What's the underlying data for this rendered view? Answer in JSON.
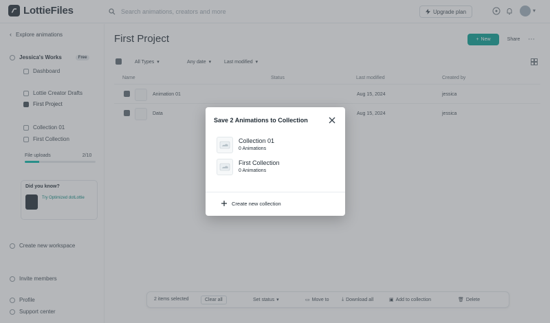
{
  "app": {
    "name": "LottieFiles"
  },
  "search": {
    "placeholder": "Search animations, creators and more"
  },
  "header": {
    "upgrade_label": "Upgrade plan",
    "user_initial": ""
  },
  "sidebar": {
    "back_label": "Explore animations",
    "workspace_name": "Jessica's Works",
    "workspace_badge": "Free",
    "items": [
      {
        "label": "Dashboard",
        "icon": "home-icon"
      },
      {
        "label": "Lottie Creator Drafts",
        "icon": "draft-icon"
      },
      {
        "label": "First Project",
        "icon": "folder-icon"
      },
      {
        "label": "Collection 01",
        "icon": "collection-icon"
      },
      {
        "label": "First Collection",
        "icon": "collection-icon"
      }
    ],
    "storage_label": "File uploads",
    "storage_value": "2/10",
    "storage_fraction": 0.2,
    "promo_title": "Did you know?",
    "promo_text": "Try Optimized dotLottie",
    "create_workspace_label": "Create new workspace",
    "invite_label": "Invite members",
    "profile_label": "Profile",
    "support_label": "Support center"
  },
  "main": {
    "title": "First Project",
    "new_label": "New",
    "share_label": "Share",
    "filters": [
      "All Types",
      "Any date",
      "Last modified"
    ],
    "columns": [
      "Name",
      "Status",
      "Last modified",
      "Created by"
    ],
    "rows": [
      {
        "name": "Animation 01",
        "status": "",
        "modified": "Aug 15, 2024",
        "author": "jessica"
      },
      {
        "name": "Data",
        "status": "",
        "modified": "Aug 15, 2024",
        "author": "jessica"
      }
    ]
  },
  "actionbar": {
    "selected_label": "2 items selected",
    "clear_label": "Clear all",
    "status_label": "Set status",
    "move_label": "Move to",
    "download_label": "Download all",
    "collection_label": "Add to collection",
    "delete_label": "Delete"
  },
  "modal": {
    "title": "Save 2 Animations to Collection",
    "collections": [
      {
        "name": "Collection 01",
        "count": "0 Animations"
      },
      {
        "name": "First Collection",
        "count": "0 Animations"
      }
    ],
    "create_label": "Create new collection"
  },
  "colors": {
    "accent": "#019d91",
    "overlay": "#5a6066"
  }
}
